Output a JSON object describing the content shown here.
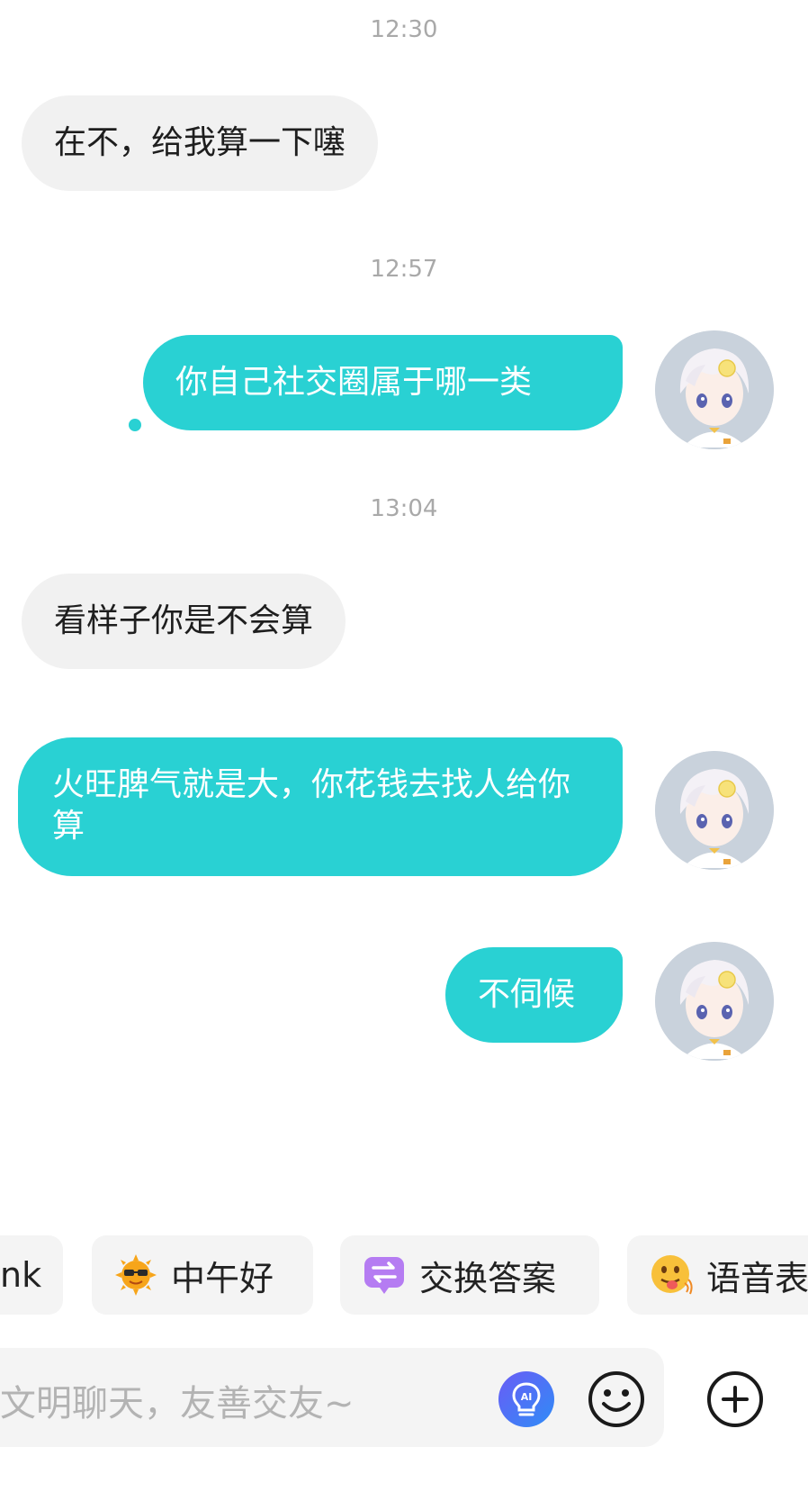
{
  "messages": [
    {
      "time": "12:30",
      "side": "left",
      "text": "在不，给我算一下噻"
    },
    {
      "time": "12:57",
      "side": "right",
      "text": "你自己社交圈属于哪一类"
    },
    {
      "time": "13:04",
      "side": "left",
      "text": "看样子你是不会算"
    },
    {
      "side": "right",
      "text": "火旺脾气就是大，你花钱去找人给你算"
    },
    {
      "side": "right",
      "text": "不伺候"
    }
  ],
  "quick_replies": [
    {
      "label": "nk",
      "icon": ""
    },
    {
      "label": "中午好",
      "icon": "sun-sunglasses-icon"
    },
    {
      "label": "交换答案",
      "icon": "exchange-icon"
    },
    {
      "label": "语音表",
      "icon": "tongue-emoji-icon"
    }
  ],
  "input": {
    "placeholder": "文明聊天，友善交友~"
  },
  "icons": {
    "ai": "ai-bulb-icon",
    "emoji": "emoji-icon",
    "add": "plus-circle-icon"
  },
  "colors": {
    "outgoing_bubble": "#29d1d3",
    "incoming_bubble": "#f1f1f1",
    "timestamp": "#a9a9a9",
    "ai_button": "#3b6ff5"
  }
}
